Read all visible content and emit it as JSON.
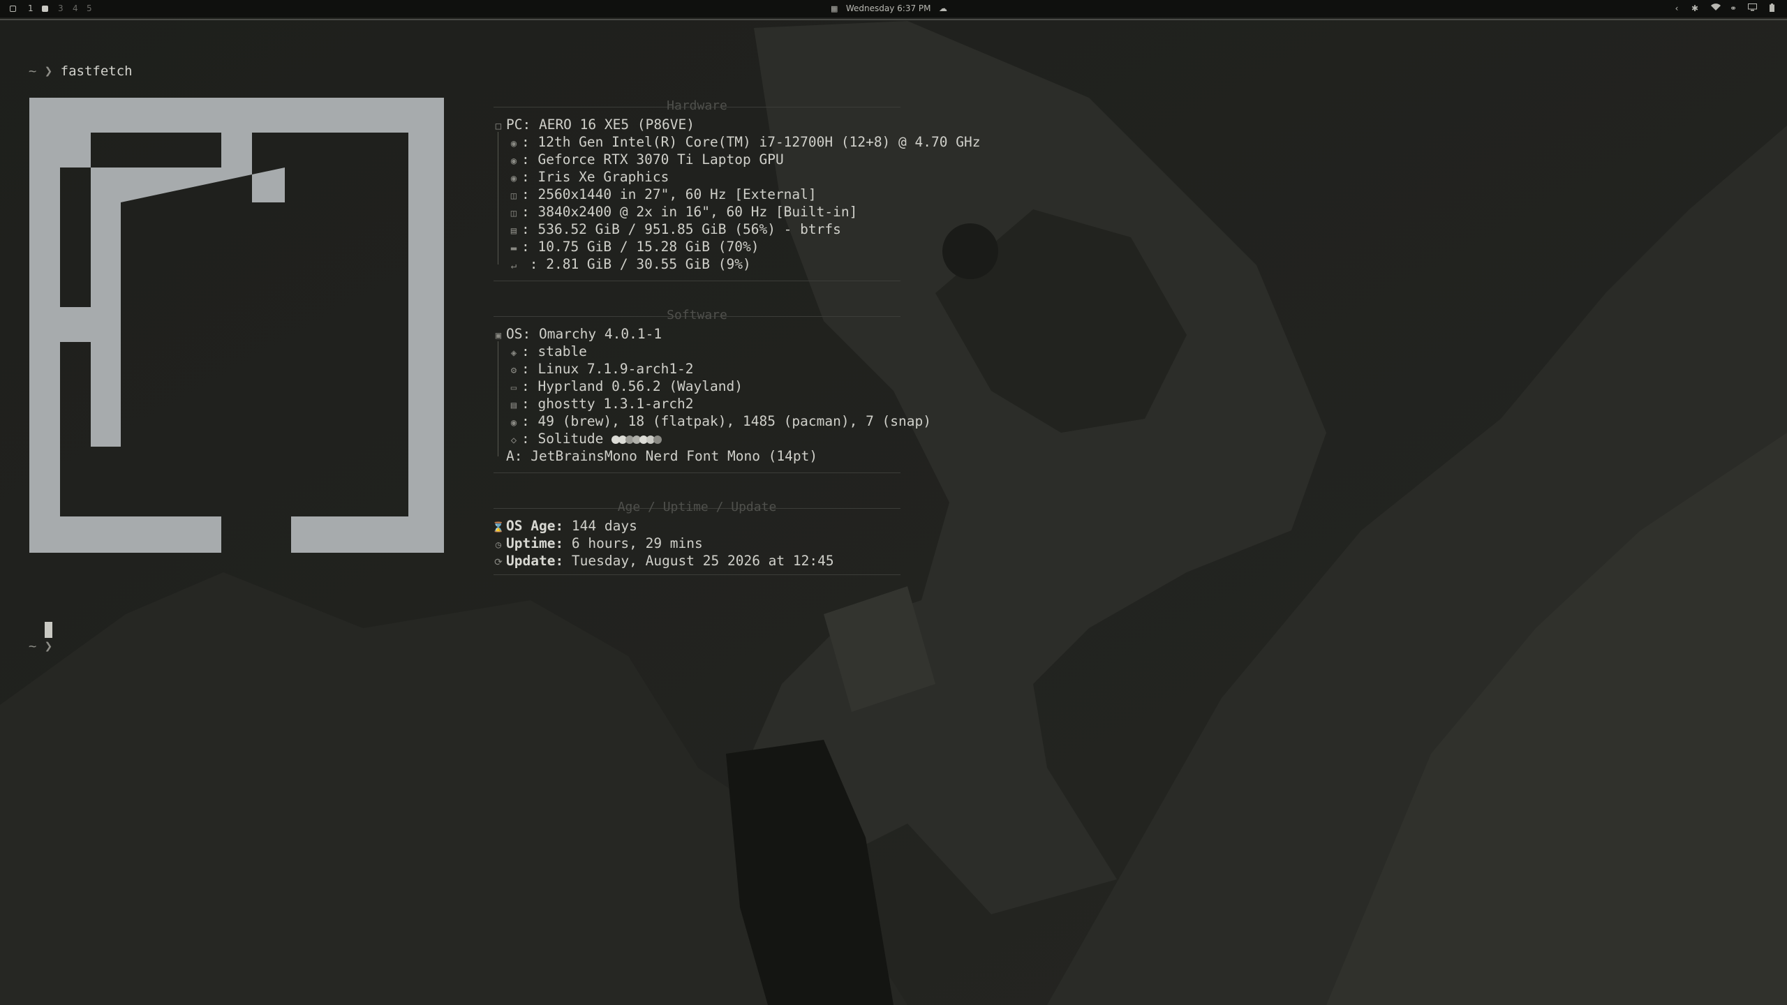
{
  "topbar": {
    "workspaces": [
      "1",
      "3",
      "4",
      "5"
    ],
    "clock": "Wednesday 6:37 PM"
  },
  "terminal": {
    "prompt": "~ ❯",
    "command": "fastfetch"
  },
  "hardware": {
    "title": "Hardware",
    "pc": "PC: AERO 16 XE5 (P86VE)",
    "cpu": ": 12th Gen Intel(R) Core(TM) i7-12700H (12+8) @ 4.70 GHz",
    "gpu1": ": Geforce RTX 3070 Ti Laptop GPU",
    "gpu2": ": Iris Xe Graphics",
    "display1": ": 2560x1440 in 27\", 60 Hz [External]",
    "display2": ": 3840x2400 @ 2x in 16\", 60 Hz [Built-in]",
    "disk": ": 536.52 GiB / 951.85 GiB (56%) - btrfs",
    "memory": ": 10.75 GiB / 15.28 GiB (70%)",
    "swap": " : 2.81 GiB / 30.55 GiB (9%)"
  },
  "software": {
    "title": "Software",
    "os": "OS: Omarchy 4.0.1-1",
    "channel": ": stable",
    "kernel": ": Linux 7.1.9-arch1-2",
    "wm": ": Hyprland 0.56.2 (Wayland)",
    "terminal": ": ghostty 1.3.1-arch2",
    "packages": ": 49 (brew), 18 (flatpak), 1485 (pacman), 7 (snap)",
    "theme": ": Solitude",
    "font": "A: JetBrainsMono Nerd Font Mono (14pt)"
  },
  "age": {
    "title": "Age / Uptime / Update",
    "os_age_label": "OS Age:",
    "os_age": " 144 days",
    "uptime_label": "Uptime:",
    "uptime": " 6 hours, 29 mins",
    "update_label": "Update:",
    "update": " Tuesday, August 25 2026 at 12:45"
  },
  "palette": {
    "background": "#1c1d1a",
    "logo": "#a7abad",
    "text": "#d0d0ca",
    "theme_dots": [
      "#dcdcd6",
      "#dcdcd6",
      "#9a9a94",
      "#b0b0aa",
      "#dcdcd6",
      "#c9c9c3",
      "#8a8a84"
    ]
  }
}
